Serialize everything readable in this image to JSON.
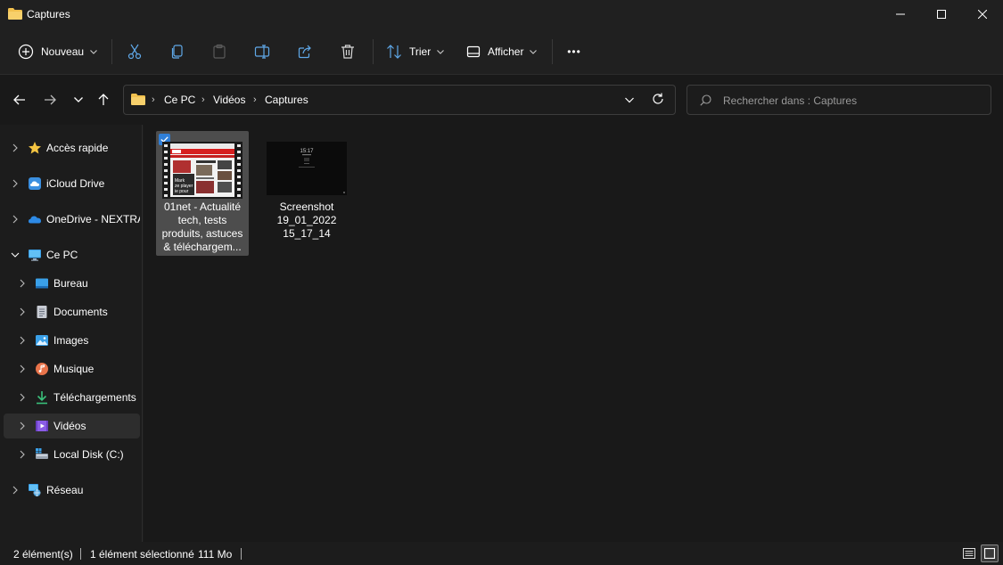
{
  "window": {
    "title": "Captures"
  },
  "toolbar": {
    "new_label": "Nouveau",
    "sort_label": "Trier",
    "view_label": "Afficher",
    "more_label": "•••"
  },
  "address": {
    "crumbs": [
      "Ce PC",
      "Vidéos",
      "Captures"
    ],
    "search_placeholder": "Rechercher dans : Captures"
  },
  "sidebar": {
    "items": [
      {
        "label": "Accès rapide",
        "icon": "star-icon"
      },
      {
        "label": "iCloud Drive",
        "icon": "icloud-icon"
      },
      {
        "label": "OneDrive - NEXTRADIO TV",
        "icon": "onedrive-icon"
      },
      {
        "label": "Ce PC",
        "icon": "computer-icon"
      },
      {
        "label": "Bureau",
        "icon": "desktop-icon"
      },
      {
        "label": "Documents",
        "icon": "documents-icon"
      },
      {
        "label": "Images",
        "icon": "images-icon"
      },
      {
        "label": "Musique",
        "icon": "music-icon"
      },
      {
        "label": "Téléchargements",
        "icon": "download-icon"
      },
      {
        "label": "Vidéos",
        "icon": "videos-icon"
      },
      {
        "label": "Local Disk (C:)",
        "icon": "disk-icon"
      },
      {
        "label": "Réseau",
        "icon": "network-icon"
      }
    ],
    "selected": "Vidéos"
  },
  "files": [
    {
      "name": "01net - Actualité tech, tests produits, astuces & téléchargem...",
      "selected": true,
      "thumb_text": "Mark ze player ie pour"
    },
    {
      "name": "Screenshot 19_01_2022 15_17_14",
      "selected": false,
      "thumb_text": "15:17"
    }
  ],
  "status": {
    "count": "2 élément(s)",
    "selection": "1 élément sélectionné",
    "size": "111 Mo"
  },
  "colors": {
    "accent": "#2f7fd8",
    "folder": "#f2c14e",
    "selected_tile": "#4d4d4d"
  }
}
